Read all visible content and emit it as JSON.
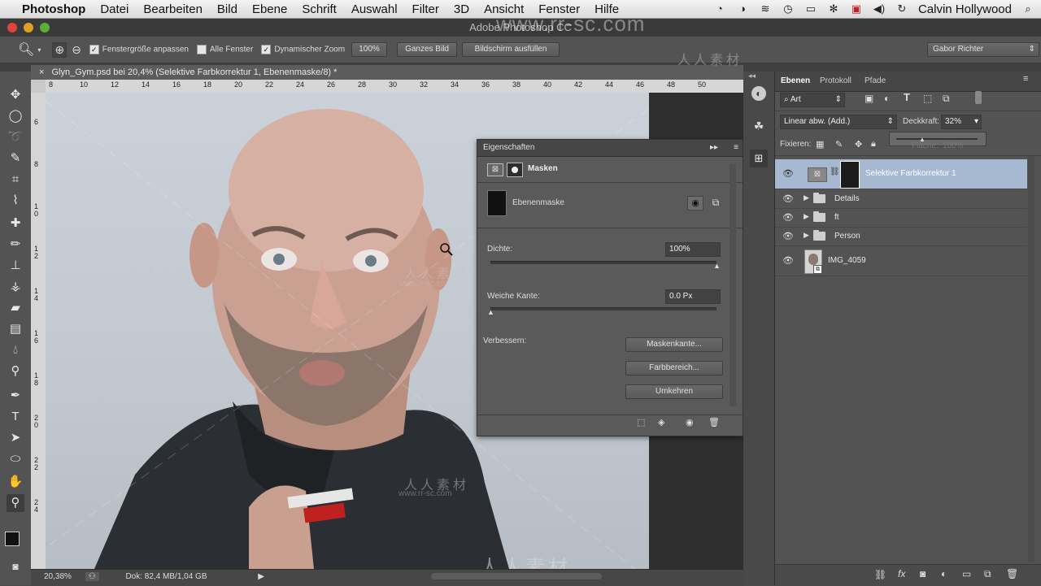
{
  "menubar": {
    "apple": "",
    "app": "Photoshop",
    "items": [
      "Datei",
      "Bearbeiten",
      "Bild",
      "Ebene",
      "Schrift",
      "Auswahl",
      "Filter",
      "3D",
      "Ansicht",
      "Fenster",
      "Hilfe"
    ],
    "user": "Calvin Hollywood"
  },
  "window": {
    "title": "Adobe Photoshop CC"
  },
  "options": {
    "fit_window": "Fenstergröße anpassen",
    "all_windows": "Alle Fenster",
    "dynamic_zoom": "Dynamischer Zoom",
    "zoom_value": "100%",
    "full_image": "Ganzes Bild",
    "fill_screen": "Bildschirm ausfüllen",
    "workspace": "Gabor Richter"
  },
  "document": {
    "tab_title": "Glyn_Gym.psd bei 20,4% (Selektive Farbkorrektur 1, Ebenenmaske/8) *",
    "ruler_h": [
      "8",
      "10",
      "12",
      "14",
      "16",
      "18",
      "20",
      "22",
      "24",
      "26",
      "28",
      "30",
      "32",
      "34",
      "36",
      "38",
      "40",
      "42",
      "44",
      "46",
      "48",
      "50"
    ],
    "ruler_v": [
      "6",
      "8",
      "1 0",
      "1 2",
      "1 4",
      "1 6",
      "1 8",
      "2 0",
      "2 2",
      "2 4"
    ],
    "zoom_status": "20,38%",
    "doc_status": "Dok: 82,4 MB/1,04 GB"
  },
  "properties": {
    "title": "Eigenschaften",
    "section": "Masken",
    "mask_label": "Ebenenmaske",
    "density_label": "Dichte:",
    "density_value": "100%",
    "feather_label": "Weiche Kante:",
    "feather_value": "0.0 Px",
    "refine_label": "Verbessern:",
    "btn_mask_edge": "Maskenkante...",
    "btn_color_range": "Farbbereich...",
    "btn_invert": "Umkehren",
    "density_level": 1.0,
    "feather_level": 0.0
  },
  "layers_panel": {
    "tabs": [
      "Ebenen",
      "Protokoll",
      "Pfade"
    ],
    "filter_kind": "Art",
    "blend_mode": "Linear abw. (Add.)",
    "opacity_label": "Deckkraft:",
    "opacity_value": "32%",
    "lock_label": "Fixieren:",
    "fill_label": "Fläche:",
    "fill_value": "100%",
    "layers": [
      {
        "name": "Selektive Farbkorrektur 1",
        "type": "adjustment",
        "selected": true
      },
      {
        "name": "Details",
        "type": "group"
      },
      {
        "name": "ft",
        "type": "group"
      },
      {
        "name": "Person",
        "type": "group"
      },
      {
        "name": "IMG_4059",
        "type": "smart"
      }
    ]
  },
  "watermark": {
    "cn": "人人素材",
    "url": "www.rr-sc.com"
  },
  "colors": {
    "accent_selected": "#a6b9d1",
    "panel_bg": "#535353"
  }
}
